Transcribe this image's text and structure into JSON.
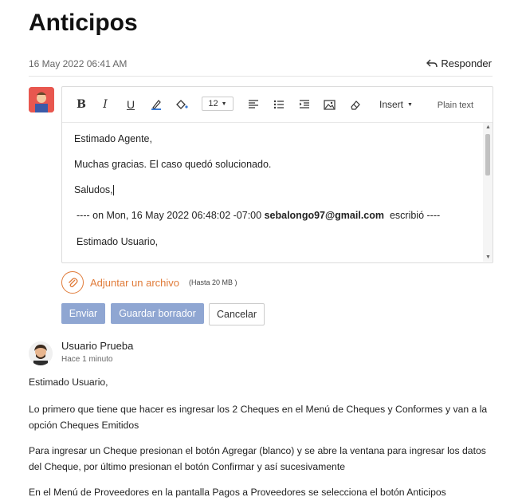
{
  "page": {
    "title": "Anticipos"
  },
  "header": {
    "date": "16 May 2022 06:41 AM",
    "reply_label": "Responder"
  },
  "toolbar": {
    "font_size": "12",
    "insert_label": "Insert",
    "plain_text_label": "Plain text",
    "icons": [
      "bold-icon",
      "italic-icon",
      "underline-icon",
      "text-color-icon",
      "highlight-icon",
      "align-left-icon",
      "bulleted-list-icon",
      "indent-icon",
      "image-icon",
      "eraser-icon"
    ]
  },
  "editor": {
    "line1": "Estimado Agente,",
    "line2": "Muchas gracias. El caso quedó solucionado.",
    "line3": "Saludos,",
    "quote_prefix": "---- on Mon, 16 May 2022 06:48:02 -07:00",
    "quote_email": "sebalongo97@gmail.com",
    "quote_suffix": "escribió ----",
    "line5": "Estimado Usuario,"
  },
  "attachment": {
    "label": "Adjuntar un archivo",
    "limit": "(Hasta 20 MB )"
  },
  "actions": {
    "send": "Enviar",
    "save_draft": "Guardar borrador",
    "cancel": "Cancelar"
  },
  "thread": {
    "author": "Usuario Prueba",
    "time": "Hace 1 minuto",
    "paragraphs": [
      "Estimado Usuario,",
      "Lo primero que tiene que hacer es ingresar los 2 Cheques en el Menú de Cheques y Conformes y van a la opción Cheques Emitidos",
      "Para ingresar un Cheque presionan el botón Agregar (blanco) y se abre la ventana para ingresar los datos del Cheque, por último presionan el botón Confirmar y así sucesivamente",
      "En el Menú de Proveedores en la pantalla Pagos a Proveedores se selecciona el botón Anticipos"
    ]
  },
  "colors": {
    "accent_orange": "#e07b39",
    "primary_button": "#8fa6d2"
  }
}
